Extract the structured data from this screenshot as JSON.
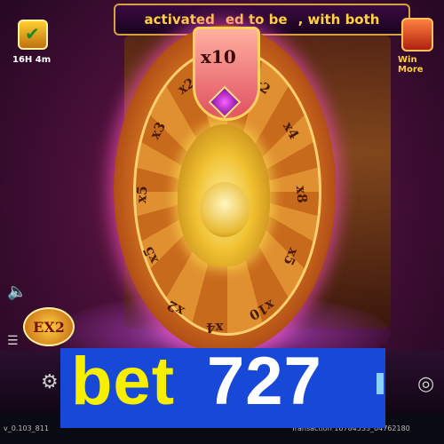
{
  "banner": {
    "part1": "activated",
    "part2": "ed to be",
    "part3": ", with both"
  },
  "wheel": {
    "pointer_label": "x10",
    "segments": [
      "x2",
      "x2",
      "x3",
      "x4",
      "x5",
      "x8",
      "x10",
      "x5",
      "x4",
      "x2",
      "x5"
    ]
  },
  "hud": {
    "left_timer": "16H 4m",
    "right_label": "Win More",
    "ex_badge": "EX2"
  },
  "headline": {
    "word": "bet",
    "number": "727"
  },
  "footer": {
    "version": "v_0.103_811",
    "right_text": "Transaction 16784533_04762180"
  },
  "colors": {
    "headline_bg": "#1848d8",
    "headline_word": "#f6f000",
    "headline_number": "#ffffff"
  }
}
